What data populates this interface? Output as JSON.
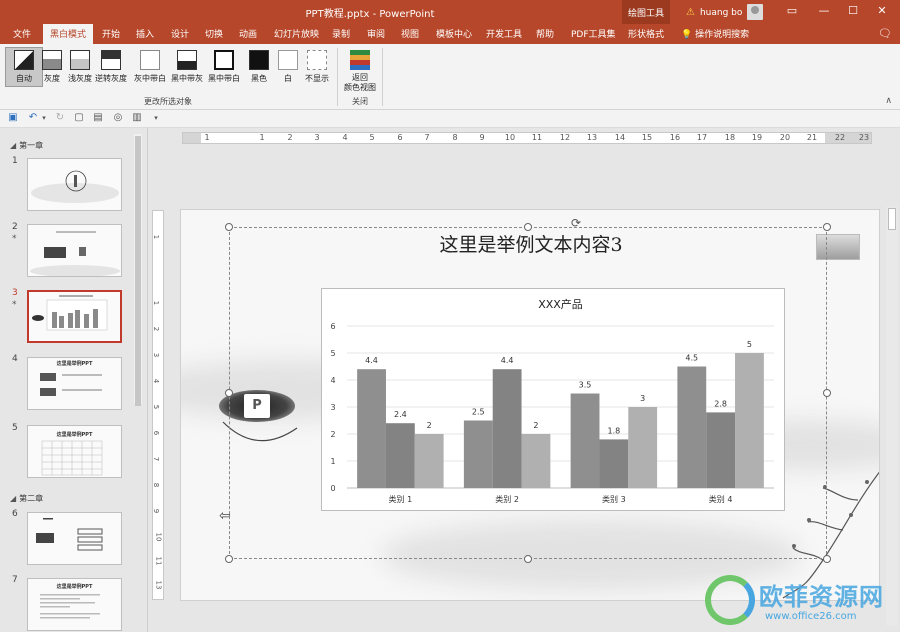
{
  "window": {
    "title": "PPT教程.pptx  -  PowerPoint",
    "context_group": "绘图工具",
    "user": "huang bo"
  },
  "tabs": [
    "文件",
    "黑白模式",
    "开始",
    "插入",
    "设计",
    "切换",
    "动画",
    "幻灯片放映",
    "录制",
    "审阅",
    "视图",
    "模板中心",
    "开发工具",
    "帮助",
    "PDF工具集",
    "形状格式",
    "操作说明搜索"
  ],
  "active_tab": "黑白模式",
  "ribbon": {
    "buttons": [
      "自动",
      "灰度",
      "浅灰度",
      "逆转灰度",
      "灰中带白",
      "黑中带灰",
      "黑中带白",
      "黑色",
      "白",
      "不显示"
    ],
    "group1_label": "更改所选对象",
    "back_button": "返回\n颜色视图",
    "group2_label": "关闭"
  },
  "thumbnails": {
    "sections": [
      "第一章",
      "第二章"
    ],
    "slides": [
      {
        "num": "1",
        "star": ""
      },
      {
        "num": "2",
        "star": "*"
      },
      {
        "num": "3",
        "star": "*",
        "active": true
      },
      {
        "num": "4",
        "star": "",
        "title": "这里是举例PPT"
      },
      {
        "num": "5",
        "star": "",
        "title": "这里是举例PPT"
      },
      {
        "num": "6",
        "star": ""
      },
      {
        "num": "7",
        "star": "",
        "title": "这里是举例PPT"
      }
    ]
  },
  "ruler": {
    "h_labels": [
      "1",
      "1",
      "2",
      "3",
      "4",
      "5",
      "6",
      "7",
      "8",
      "9",
      "10",
      "11",
      "12",
      "13",
      "14",
      "15",
      "16",
      "17",
      "18",
      "19",
      "20",
      "21",
      "22",
      "23"
    ],
    "v_labels": [
      "1",
      "1",
      "2",
      "3",
      "4",
      "5",
      "6",
      "7",
      "8",
      "9",
      "10",
      "11",
      "12",
      "13"
    ]
  },
  "slide": {
    "title": "这里是举例文本内容3"
  },
  "chart_data": {
    "type": "bar",
    "title": "XXX产品",
    "categories": [
      "类别 1",
      "类别 2",
      "类别 3",
      "类别 4"
    ],
    "series": [
      {
        "values": [
          4.4,
          2.5,
          3.5,
          4.5
        ],
        "color": "#8f8f8f"
      },
      {
        "values": [
          2.4,
          4.4,
          1.8,
          2.8
        ],
        "color": "#838383"
      },
      {
        "values": [
          2,
          2,
          3,
          5
        ],
        "color": "#b0b0b0"
      }
    ],
    "ylim": [
      0,
      6
    ],
    "yticks": [
      0,
      1,
      2,
      3,
      4,
      5,
      6
    ],
    "grid": true
  },
  "watermark": {
    "text": "欧菲资源网",
    "url": "www.office26.com"
  }
}
